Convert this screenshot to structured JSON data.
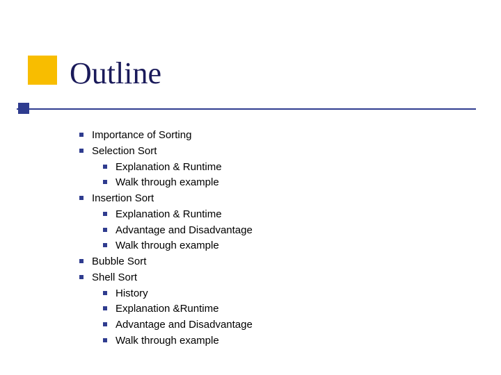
{
  "title": "Outline",
  "items": [
    {
      "label": "Importance of Sorting"
    },
    {
      "label": "Selection Sort",
      "children": [
        {
          "label": "Explanation & Runtime"
        },
        {
          "label": "Walk through example"
        }
      ]
    },
    {
      "label": "Insertion Sort",
      "children": [
        {
          "label": "Explanation & Runtime"
        },
        {
          "label": "Advantage and Disadvantage"
        },
        {
          "label": "Walk through example"
        }
      ]
    },
    {
      "label": "Bubble Sort"
    },
    {
      "label": "Shell Sort",
      "children": [
        {
          "label": "History"
        },
        {
          "label": "Explanation &Runtime"
        },
        {
          "label": "Advantage and Disadvantage"
        },
        {
          "label": "Walk through example"
        }
      ]
    }
  ]
}
